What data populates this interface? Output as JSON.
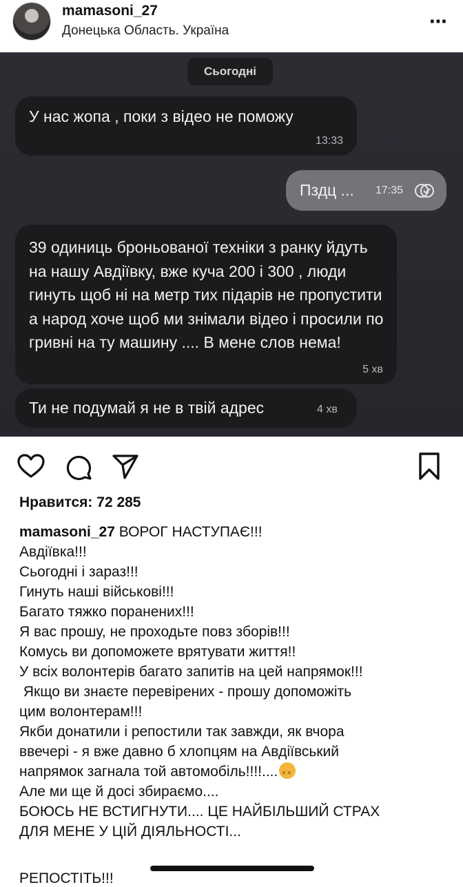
{
  "header": {
    "username": "mamasoni_27",
    "location": "Донецька Область. Україна",
    "more_icon": "⋯"
  },
  "chat": {
    "date_label": "Сьогодні",
    "messages": [
      {
        "text": "У нас жопа , поки з відео не поможу",
        "time": "13:33"
      },
      {
        "text": "Пздц ...",
        "time": "17:35"
      },
      {
        "text": "39 одиниць броньованої техніки з ранку йдуть на нашу Авдіївку, вже куча 200 і 300 , люди гинуть щоб ні на метр тих підарів не пропустити а народ хоче щоб ми знімали відео і просили по гривні на ту машину .... В мене слов нема!",
        "time": "5 хв"
      },
      {
        "text": "Ти не подумай я не в твій адрес",
        "time": "4 хв"
      }
    ]
  },
  "actions": {
    "icons": [
      "heart-icon",
      "comment-icon",
      "send-icon",
      "bookmark-icon"
    ]
  },
  "likes": "Нравится: 72 285",
  "caption": {
    "user": "mamasoni_27",
    "lines": [
      "ВОРОГ НАСТУПАЄ!!!",
      "Авдіївка!!!",
      "Сьогодні і зараз!!!",
      "Гинуть наші військові!!!",
      "Багато тяжко поранених!!!",
      "Я вас прошу, не проходьте повз зборів!!!",
      "Комусь ви допоможете врятувати життя!!",
      "У всіх волонтерів багато запитів на цей напрямок!!!",
      " Якщо ви знаєте перевірених - прошу допоможіть",
      "цим волонтерам!!!",
      "Якби донатили і репостили так завжди, як вчора",
      "ввечері - я вже давно б хлопцям на Авдіївський",
      "напрямок загнала той автомобіль!!!!....",
      "Але ми ще й досі збираємо....",
      "БОЮСЬ НЕ ВСТИГНУТИ.... ЦЕ НАЙБІЛЬШИЙ СТРАХ",
      "ДЛЯ МЕНЕ У ЦІЙ ДІЯЛЬНОСТІ..."
    ],
    "cut_line": "РЕПОСТІТЬ!!!"
  }
}
